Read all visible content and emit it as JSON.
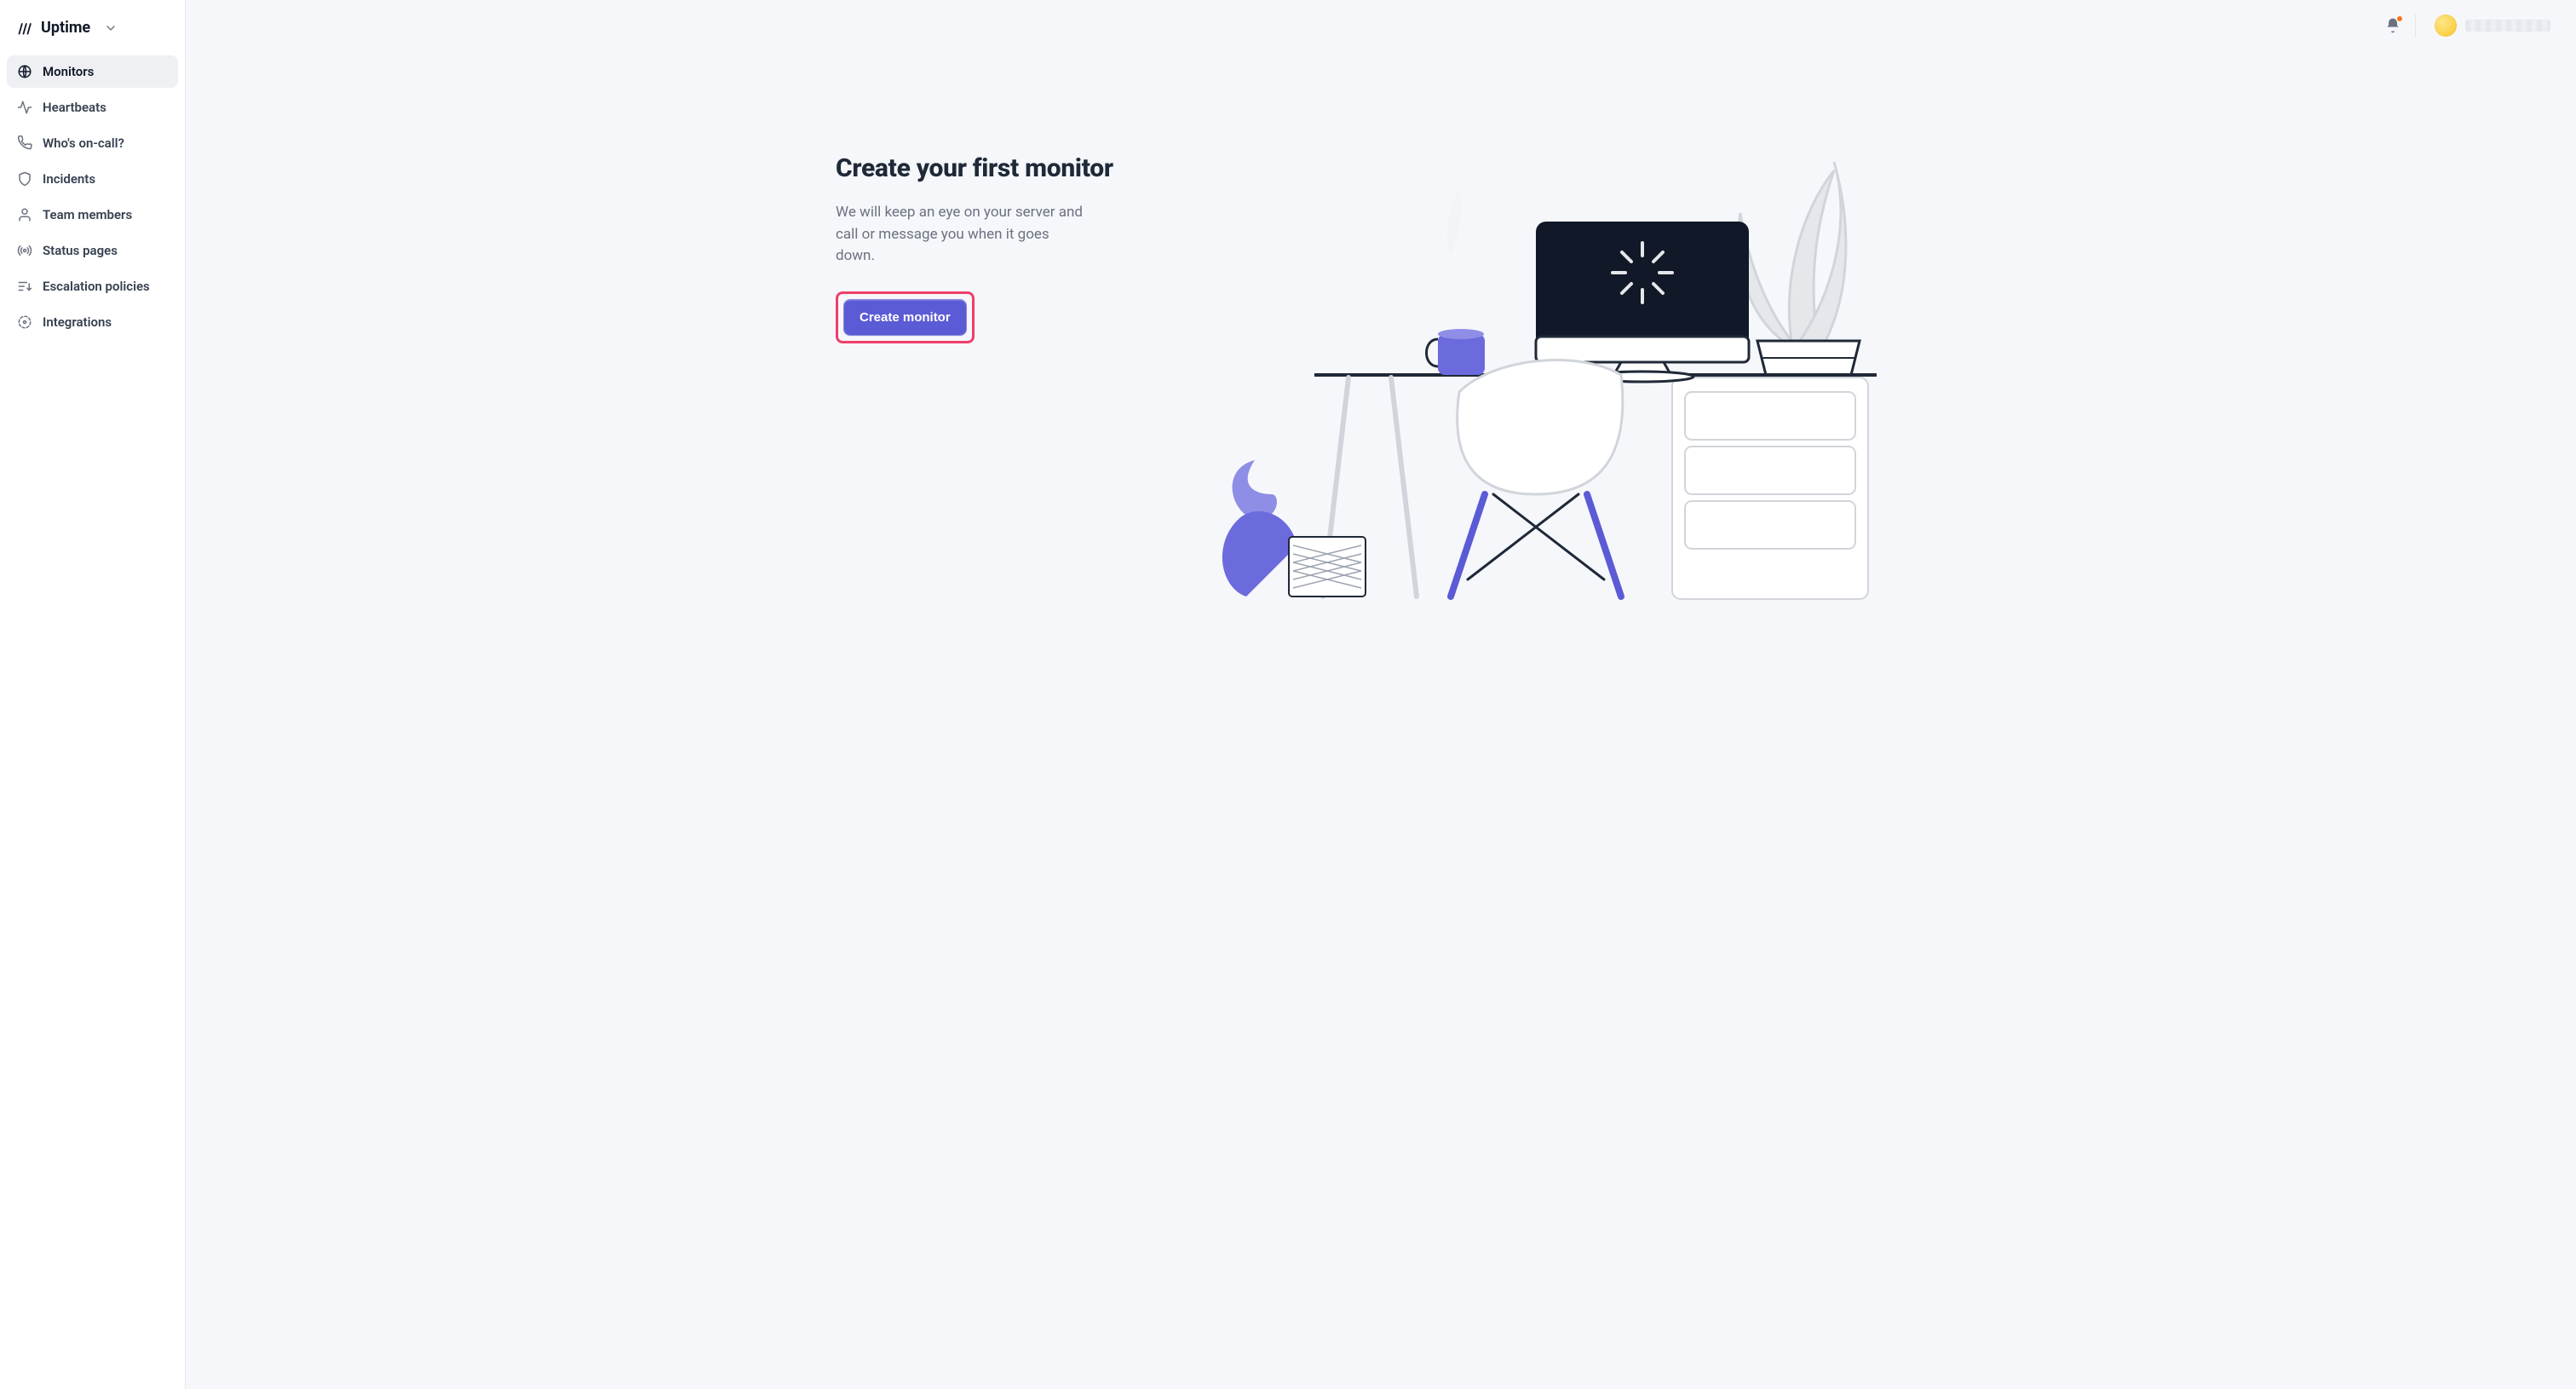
{
  "brand": {
    "name": "Uptime"
  },
  "sidebar": {
    "items": [
      {
        "label": "Monitors"
      },
      {
        "label": "Heartbeats"
      },
      {
        "label": "Who's on-call?"
      },
      {
        "label": "Incidents"
      },
      {
        "label": "Team members"
      },
      {
        "label": "Status pages"
      },
      {
        "label": "Escalation policies"
      },
      {
        "label": "Integrations"
      }
    ]
  },
  "hero": {
    "title": "Create your first monitor",
    "description": "We will keep an eye on your server and call or message you when it goes down.",
    "cta_label": "Create monitor"
  },
  "colors": {
    "accent": "#5b5bd6",
    "highlight": "#ef3f6a",
    "notif": "#f97316"
  }
}
